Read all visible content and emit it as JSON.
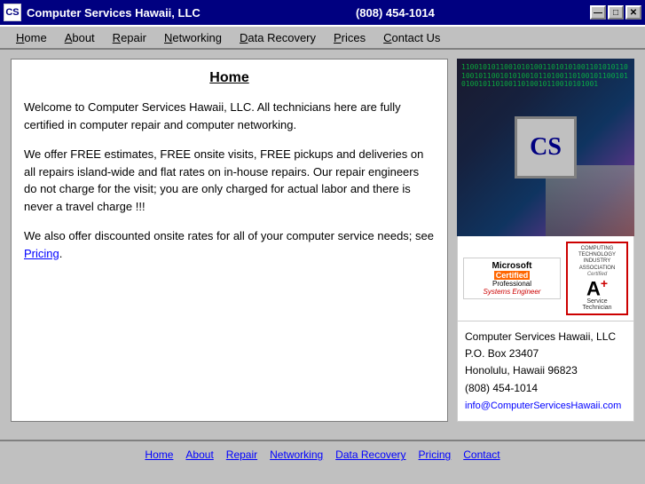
{
  "titleBar": {
    "logo": "CS",
    "title": "Computer Services Hawaii, LLC",
    "phone": "(808) 454-1014",
    "controls": {
      "minimize": "—",
      "maximize": "□",
      "close": "✕"
    }
  },
  "menuBar": {
    "items": [
      {
        "id": "home",
        "label": "Home",
        "underline": "H"
      },
      {
        "id": "about",
        "label": "About",
        "underline": "A"
      },
      {
        "id": "repair",
        "label": "Repair",
        "underline": "R"
      },
      {
        "id": "networking",
        "label": "Networking",
        "underline": "N"
      },
      {
        "id": "data-recovery",
        "label": "Data Recovery",
        "underline": "D"
      },
      {
        "id": "prices",
        "label": "Prices",
        "underline": "P"
      },
      {
        "id": "contact-us",
        "label": "Contact Us",
        "underline": "C"
      }
    ]
  },
  "mainContent": {
    "heading": "Home",
    "paragraph1": "Welcome to Computer Services Hawaii, LLC. All technicians here are fully certified in computer repair and computer networking.",
    "paragraph2": "We offer FREE estimates, FREE onsite visits, FREE pickups and deliveries on all repairs island-wide and flat rates on in-house repairs. Our repair engineers do not charge for the visit; you are only charged for actual labor and there is never a travel charge !!!",
    "paragraph3_pre": "We also offer discounted onsite rates for all of your computer service needs; see ",
    "paragraph3_link": "Pricing",
    "paragraph3_post": "."
  },
  "companyInfo": {
    "name": "Computer Services Hawaii, LLC",
    "poBox": "P.O. Box 23407",
    "city": "Honolulu, Hawaii 96823",
    "phone": "(808) 454-1014",
    "email": "info@ComputerServicesHawaii.com"
  },
  "certifications": {
    "microsoft": {
      "logo": "Microsoft",
      "certified": "Certified",
      "professional": "Professional",
      "role": "Systems Engineer"
    },
    "aplus": {
      "association": "COMPUTING TECHNOLOGY INDUSTRY ASSOCIATION",
      "certified_label": "Certified",
      "grade": "A",
      "plus": "+",
      "service": "Service",
      "technician": "Technician"
    }
  },
  "footerNav": {
    "items": [
      {
        "id": "home",
        "label": "Home"
      },
      {
        "id": "about",
        "label": "About"
      },
      {
        "id": "repair",
        "label": "Repair"
      },
      {
        "id": "networking",
        "label": "Networking"
      },
      {
        "id": "data-recovery",
        "label": "Data Recovery"
      },
      {
        "id": "pricing",
        "label": "Pricing"
      },
      {
        "id": "contact",
        "label": "Contact"
      }
    ]
  },
  "binaryText": "11001010110010101001101010100110101011010010110010101001011010011010010110010101001011010011010010110010101001"
}
